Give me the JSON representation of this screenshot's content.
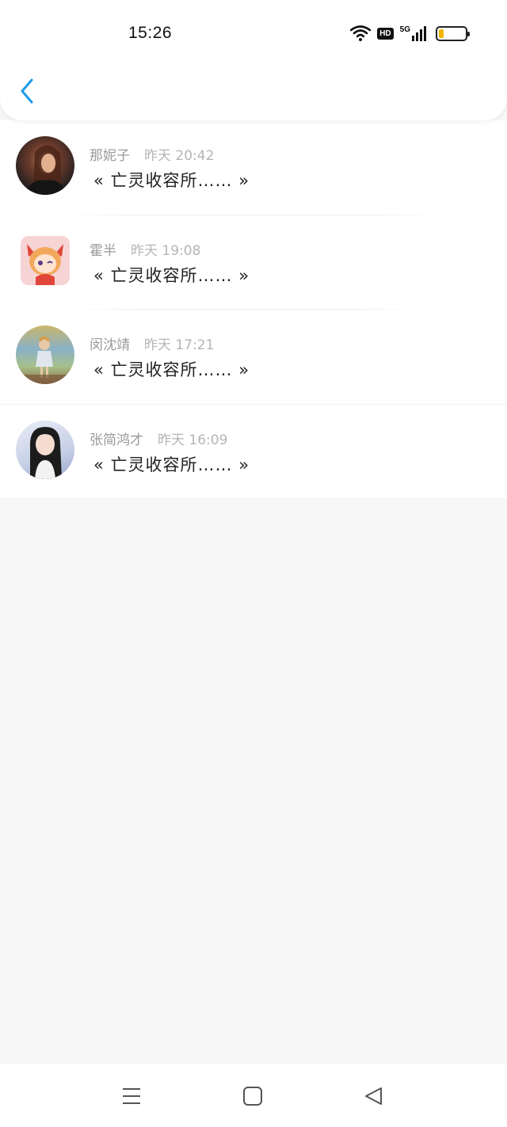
{
  "status_bar": {
    "time": "15:26",
    "icons": [
      "wifi-icon",
      "hd-icon",
      "5g-signal-icon",
      "battery-icon"
    ],
    "hd_label": "HD",
    "network_label": "5G",
    "battery_level": 0.2,
    "battery_color": "#f4b400"
  },
  "header": {
    "back_icon": "chevron-left-icon",
    "accent": "#1e9be9"
  },
  "messages": [
    {
      "name": "那妮子",
      "time": "昨天 20:42",
      "message": "« 亡灵收容所…… »"
    },
    {
      "name": "霍半",
      "time": "昨天 19:08",
      "message": "« 亡灵收容所…… »"
    },
    {
      "name": "闵沈靖",
      "time": "昨天 17:21",
      "message": "« 亡灵收容所…… »"
    },
    {
      "name": "张简鸿才",
      "time": "昨天 16:09",
      "message": "« 亡灵收容所…… »"
    }
  ],
  "navbar": {
    "icons": [
      "menu-icon",
      "home-icon",
      "back-triangle-icon"
    ]
  }
}
